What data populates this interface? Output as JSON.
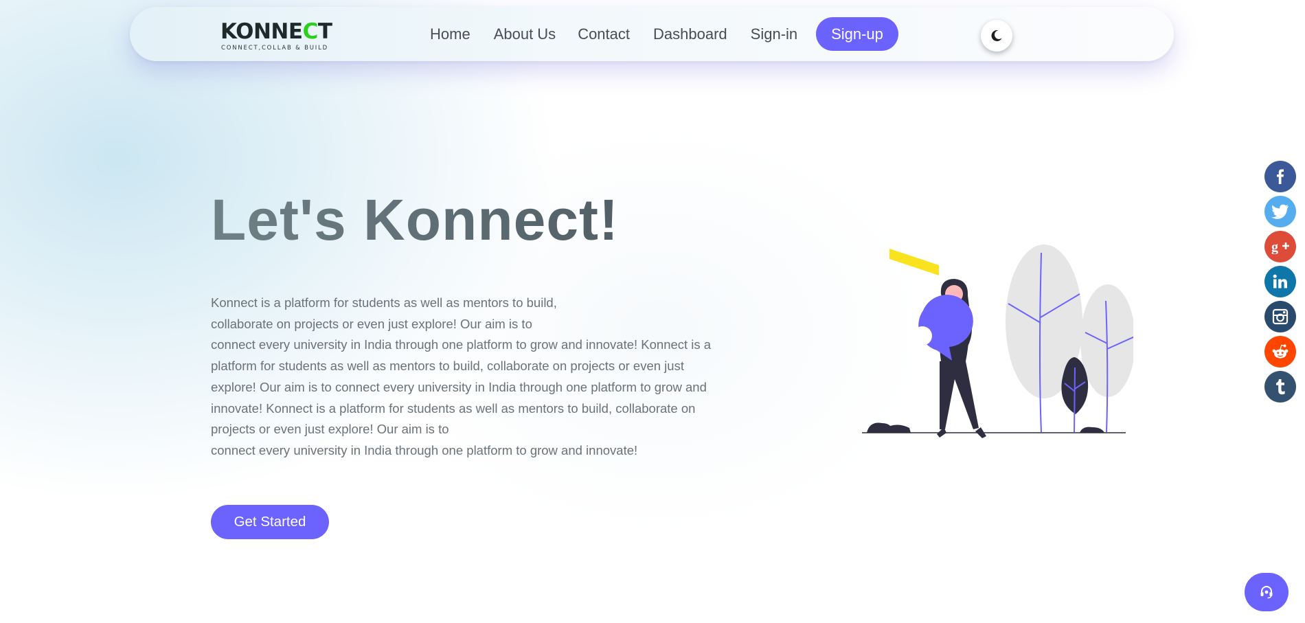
{
  "brand": {
    "logo_main": "KONNE",
    "logo_accent": "C",
    "logo_end": "T",
    "tagline": "CONNECT,COLLAB & BUILD"
  },
  "nav": {
    "items": [
      {
        "label": "Home"
      },
      {
        "label": "About Us"
      },
      {
        "label": "Contact"
      },
      {
        "label": "Dashboard"
      },
      {
        "label": "Sign-in"
      }
    ],
    "signup_label": "Sign-up",
    "theme_toggle_icon": "moon-icon"
  },
  "hero": {
    "title": "Let's Konnect!",
    "lines": [
      "Konnect is a platform for students as well as mentors to build,",
      "collaborate on projects or even just explore! Our aim is to",
      "connect every university in India through one platform to grow and innovate! Konnect is a platform for students as well as mentors to build, collaborate on projects or even just explore! Our aim is to connect every university in India through one platform to grow and",
      "innovate! Konnect is a platform for students as well as mentors to build, collaborate on projects or even just explore! Our aim is to",
      "connect every university in India through one platform to grow and innovate!"
    ],
    "cta_label": "Get Started"
  },
  "social": [
    {
      "name": "facebook-icon",
      "glyph": "f",
      "color": "#3b5998"
    },
    {
      "name": "twitter-icon",
      "glyph": "t",
      "color": "#55acee"
    },
    {
      "name": "google-plus-icon",
      "glyph": "g+",
      "color": "#dd4b39"
    },
    {
      "name": "linkedin-icon",
      "glyph": "in",
      "color": "#0e76a8"
    },
    {
      "name": "instagram-icon",
      "glyph": "ig",
      "color": "#2a4a6d"
    },
    {
      "name": "reddit-icon",
      "glyph": "r",
      "color": "#ff4500"
    },
    {
      "name": "tumblr-icon",
      "glyph": "t",
      "color": "#34526f"
    }
  ],
  "support": {
    "icon": "headset-icon"
  },
  "colors": {
    "accent": "#6c63ff",
    "illustration_purple": "#6c63ff",
    "illustration_yellow": "#f9e21e",
    "illustration_dark": "#2f2e41",
    "illustration_tree": "#e6e6e6"
  }
}
